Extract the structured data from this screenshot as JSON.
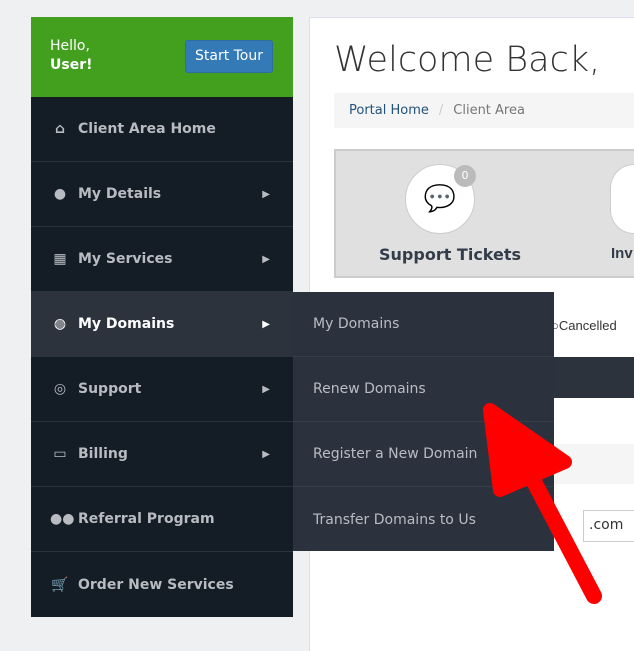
{
  "sidebar": {
    "greeting": "Hello,",
    "user": "User!",
    "start_tour": "Start Tour",
    "items": [
      {
        "label": "Client Area Home",
        "icon": "home-icon"
      },
      {
        "label": "My Details",
        "icon": "user-icon"
      },
      {
        "label": "My Services",
        "icon": "grid-icon"
      },
      {
        "label": "My Domains",
        "icon": "globe-icon"
      },
      {
        "label": "Support",
        "icon": "lifebuoy-icon"
      },
      {
        "label": "Billing",
        "icon": "money-icon"
      },
      {
        "label": "Referral Program",
        "icon": "users-icon"
      },
      {
        "label": "Order New Services",
        "icon": "cart-plus-icon"
      }
    ]
  },
  "submenu": [
    "My Domains",
    "Renew Domains",
    "Register a New Domain",
    "Transfer Domains to Us"
  ],
  "main": {
    "title": "Welcome Back,",
    "breadcrumb": [
      "Portal Home",
      "Client Area"
    ],
    "tiles": [
      {
        "label": "Support Tickets",
        "count": "0"
      },
      {
        "label": "Inv"
      }
    ],
    "filter": "Cancelled",
    "tld": ".com"
  },
  "colors": {
    "header": "#43a01f",
    "sidebar": "#141c26",
    "button": "#337ab7",
    "arrow": "#ff0000"
  }
}
